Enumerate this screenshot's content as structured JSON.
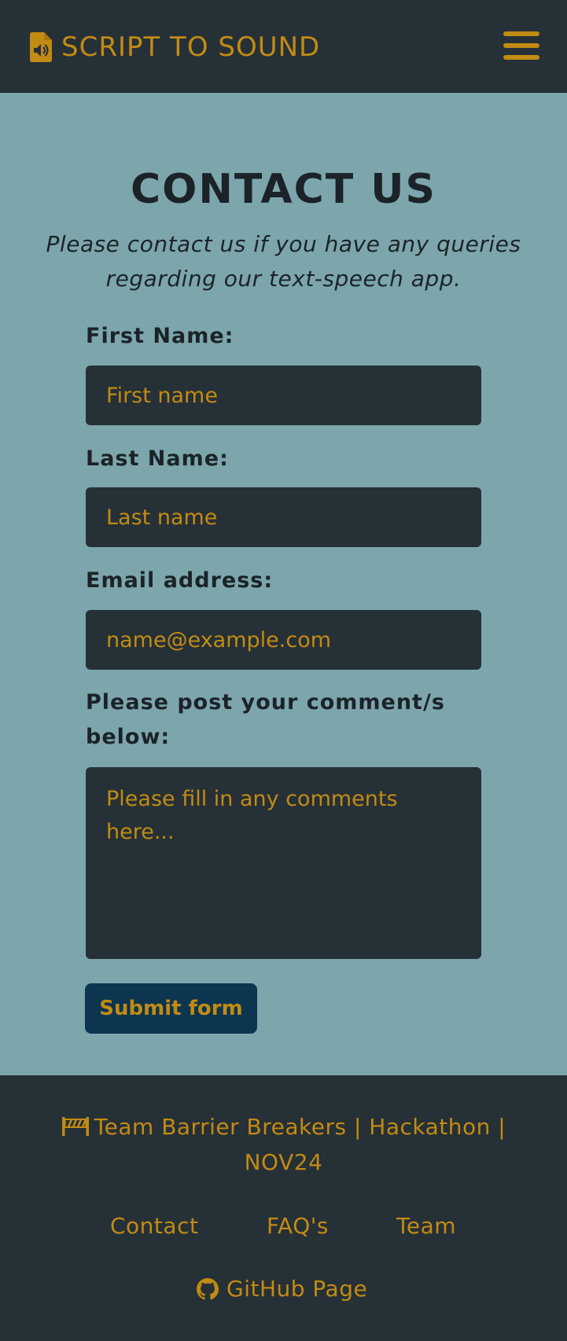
{
  "navbar": {
    "brand_text": "SCRIPT TO SOUND",
    "brand_icon": "file-audio-icon",
    "menu_icon": "hamburger-menu-icon"
  },
  "main": {
    "title": "CONTACT US",
    "subtitle": "Please contact us if you have any queries regarding our text-speech app."
  },
  "form": {
    "first_name_label": "First Name:",
    "first_name_placeholder": "First name",
    "last_name_label": "Last Name:",
    "last_name_placeholder": "Last name",
    "email_label": "Email address:",
    "email_placeholder": "name@example.com",
    "comments_label": "Please post your comment/s below:",
    "comments_placeholder": "Please fill in any comments here...",
    "submit_label": "Submit form"
  },
  "footer": {
    "team_text": "Team Barrier Breakers | Hackathon | NOV24",
    "team_icon": "road-barrier-icon",
    "links": [
      "Contact",
      "FAQ's",
      "Team"
    ],
    "github_label": "GitHub Page",
    "github_icon": "github-icon"
  },
  "colors": {
    "navbar_bg": "#263037",
    "page_bg": "#7ca6ac",
    "accent": "#c28b13",
    "text_dark": "#1b2328",
    "field_bg": "#263037",
    "button_bg": "#0c3550"
  }
}
